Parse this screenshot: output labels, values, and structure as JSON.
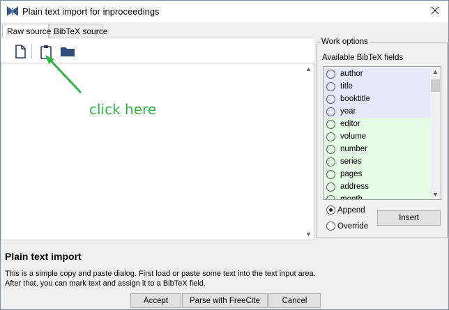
{
  "window": {
    "title": "Plain text import for inproceedings"
  },
  "tabs": [
    {
      "label": "Raw source"
    },
    {
      "label": "BibTeX source"
    }
  ],
  "toolbar": {
    "new_icon": "new-document-icon",
    "paste_icon": "clipboard-paste-icon",
    "open_icon": "folder-open-icon"
  },
  "annotation": {
    "text": "click here",
    "color": "#33b34a"
  },
  "work_options": {
    "legend": "Work options",
    "fields_label": "Available BibTeX fields",
    "fields": [
      {
        "name": "author",
        "group": "required"
      },
      {
        "name": "title",
        "group": "required"
      },
      {
        "name": "booktitle",
        "group": "required"
      },
      {
        "name": "year",
        "group": "required"
      },
      {
        "name": "editor",
        "group": "optional"
      },
      {
        "name": "volume",
        "group": "optional"
      },
      {
        "name": "number",
        "group": "optional"
      },
      {
        "name": "series",
        "group": "optional"
      },
      {
        "name": "pages",
        "group": "optional"
      },
      {
        "name": "address",
        "group": "optional"
      },
      {
        "name": "month",
        "group": "optional"
      }
    ],
    "colors": {
      "required": "#e6e8fb",
      "optional": "#e6fbe6"
    },
    "append_label": "Append",
    "override_label": "Override",
    "selected_mode": "Append",
    "insert_label": "Insert"
  },
  "help": {
    "title": "Plain text import",
    "line1": "This is a simple copy and paste dialog. First load or paste some text into the text input area.",
    "line2": "After that, you can mark text and assign it to a BibTeX field."
  },
  "buttons": {
    "accept": "Accept",
    "parse": "Parse with FreeCite",
    "cancel": "Cancel"
  }
}
